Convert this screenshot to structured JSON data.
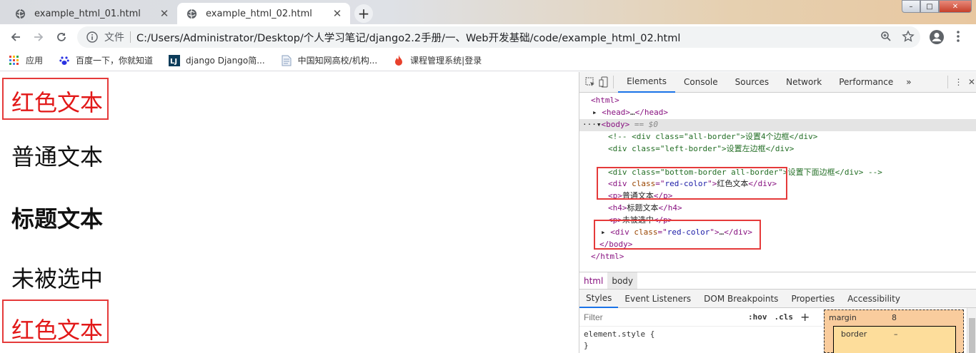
{
  "browser": {
    "tabs": [
      {
        "title": "example_html_01.html",
        "active": false
      },
      {
        "title": "example_html_02.html",
        "active": true
      }
    ],
    "new_tab_symbol": "+",
    "window_controls": {
      "minimize": "–",
      "maximize": "□",
      "close": "✕"
    },
    "address": {
      "scheme_label": "文件",
      "url": "C:/Users/Administrator/Desktop/个人学习笔记/django2.2手册/一、Web开发基础/code/example_html_02.html"
    },
    "bookmarks": [
      {
        "label": "应用",
        "icon": "apps-grid-icon"
      },
      {
        "label": "百度一下，你就知道",
        "icon": "baidu-paw-icon"
      },
      {
        "label": "django Django简...",
        "icon": "lj-logo-icon"
      },
      {
        "label": "中国知网高校/机构...",
        "icon": "document-icon"
      },
      {
        "label": "课程管理系统|登录",
        "icon": "flame-icon"
      }
    ]
  },
  "page": {
    "items": [
      {
        "text": "红色文本",
        "style": "red-boxed"
      },
      {
        "text": "普通文本",
        "style": "normal"
      },
      {
        "text": "标题文本",
        "style": "heading"
      },
      {
        "text": "未被选中",
        "style": "normal"
      },
      {
        "text": "红色文本",
        "style": "red-boxed"
      }
    ],
    "colors": {
      "red_text": "#e21818",
      "box_border": "#e53a3a"
    }
  },
  "devtools": {
    "tabs": [
      "Elements",
      "Console",
      "Sources",
      "Network",
      "Performance",
      "»"
    ],
    "active_tab": "Elements",
    "dom": {
      "l1": "<html>",
      "l2a": "<head>",
      "l2b": "…",
      "l2c": "</head>",
      "l3a": "<body>",
      "l3b": "== $0",
      "l4": "<!-- <div class=\"all-border\">设置4个边框</div>",
      "l5a": "<div ",
      "l5b": "class",
      "l5c": "=\"",
      "l5d": "left-border",
      "l5e": "\">",
      "l5f": "设置左边框",
      "l5g": "</div>",
      "l6": "<div class=\"bottom-border all-border\">设置下面边框</div> -->",
      "l7a": "<div ",
      "l7b": "class",
      "l7c": "=\"",
      "l7d": "red-color",
      "l7e": "\">",
      "l7f": "红色文本",
      "l7g": "</div>",
      "l8a": "<p>",
      "l8b": "普通文本",
      "l8c": "</p>",
      "l9a": "<h4>",
      "l9b": "标题文本",
      "l9c": "</h4>",
      "l10a": "<p>",
      "l10b": "未被选中",
      "l10c": "</p>",
      "l11a": "<div ",
      "l11b": "class",
      "l11c": "=\"",
      "l11d": "red-color",
      "l11e": "\">",
      "l11f": "…",
      "l11g": "</div>",
      "l12": "</body>",
      "l13": "</html>"
    },
    "breadcrumbs": [
      "html",
      "body"
    ],
    "subtabs": [
      "Styles",
      "Event Listeners",
      "DOM Breakpoints",
      "Properties",
      "Accessibility"
    ],
    "active_subtab": "Styles",
    "styles": {
      "filter_placeholder": "Filter",
      "hov": ":hov",
      "cls": ".cls",
      "add": "+",
      "rule1": "element.style {",
      "rule2": "}"
    },
    "box_model": {
      "margin_label": "margin",
      "margin_value": "8",
      "border_label": "border",
      "border_value": "–"
    }
  }
}
